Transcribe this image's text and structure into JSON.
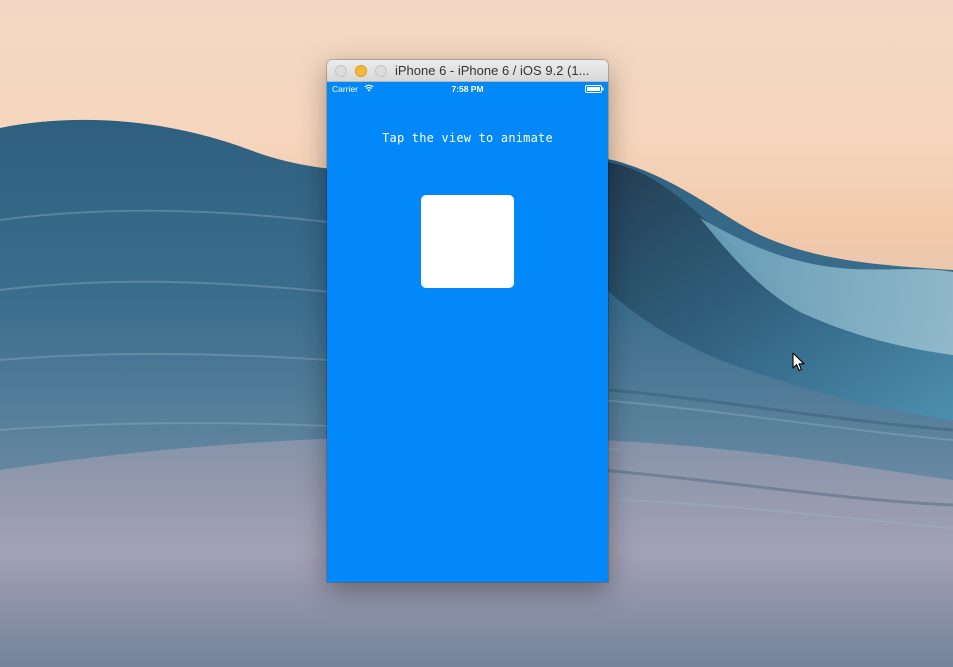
{
  "desktop": {
    "wallpaper": "wave-wallpaper"
  },
  "window": {
    "title": "iPhone 6 - iPhone 6 / iOS 9.2 (1...",
    "buttons": [
      "close",
      "minimize",
      "zoom"
    ]
  },
  "statusbar": {
    "carrier": "Carrier",
    "time": "7:58 PM",
    "icons": [
      "wifi-icon",
      "battery-icon"
    ]
  },
  "app": {
    "hint": "Tap the view to animate",
    "background_color": "#0388f9",
    "square_color": "#ffffff"
  },
  "cursor": {
    "icon": "arrow-cursor-icon"
  }
}
